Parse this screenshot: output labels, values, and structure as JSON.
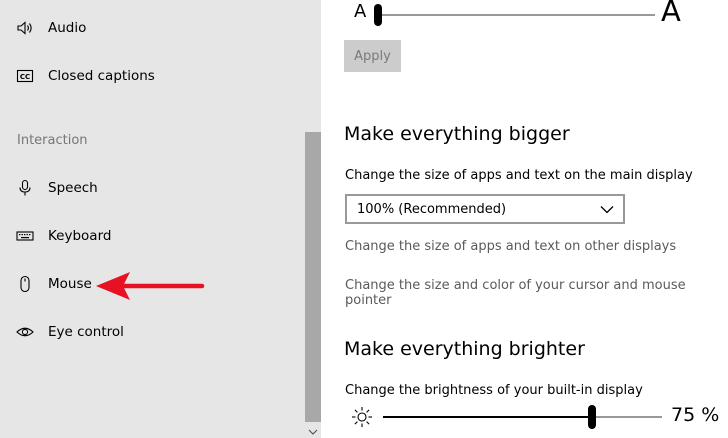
{
  "sidebar": {
    "items": [
      {
        "label": "Audio",
        "icon": "speaker-icon"
      },
      {
        "label": "Closed captions",
        "icon": "closed-captions-icon"
      },
      {
        "label": "Speech",
        "icon": "microphone-icon"
      },
      {
        "label": "Keyboard",
        "icon": "keyboard-icon"
      },
      {
        "label": "Mouse",
        "icon": "mouse-icon"
      },
      {
        "label": "Eye control",
        "icon": "eye-icon"
      }
    ],
    "section_label": "Interaction"
  },
  "main": {
    "text_size": {
      "small_label": "A",
      "large_label": "A",
      "apply_label": "Apply"
    },
    "bigger": {
      "heading": "Make everything bigger",
      "description": "Change the size of apps and text on the main display",
      "dropdown_value": "100% (Recommended)",
      "other_displays_link": "Change the size of apps and text on other displays",
      "cursor_link": "Change the size and color of your cursor and mouse pointer"
    },
    "brighter": {
      "heading": "Make everything brighter",
      "description": "Change the brightness of your built-in display",
      "brightness_value": "75 %",
      "brightness_level": 0.75
    }
  },
  "annotation": {
    "arrow_color": "#e81123",
    "points_to": "Mouse"
  }
}
